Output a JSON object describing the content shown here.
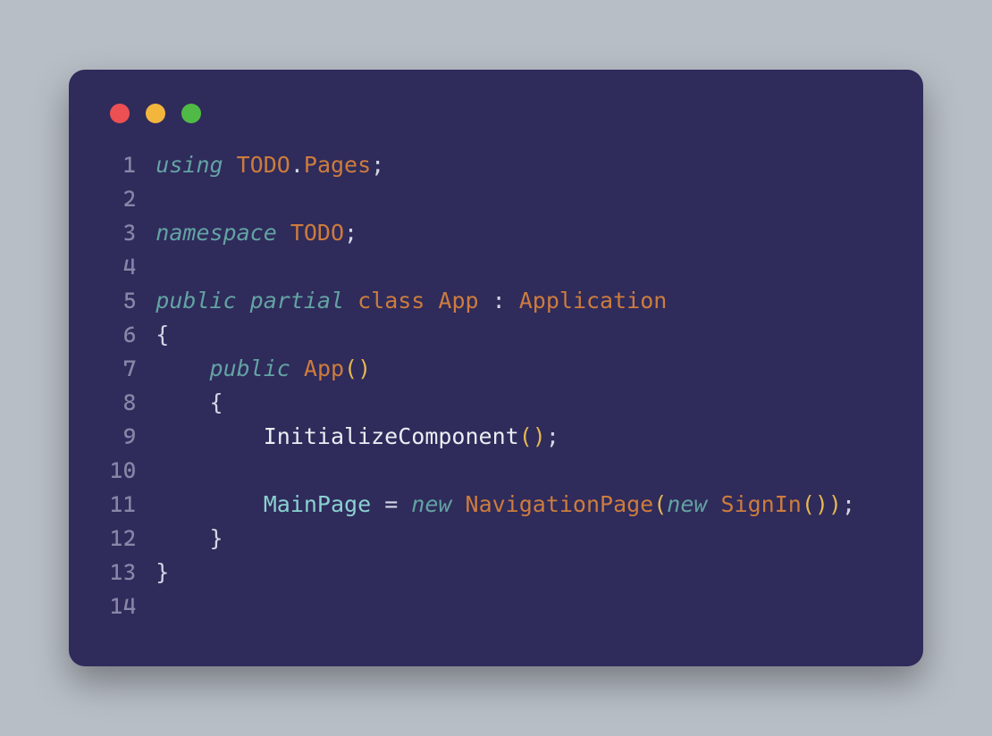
{
  "window": {
    "language": "csharp"
  },
  "lineNumbers": [
    "1",
    "2",
    "3",
    "4",
    "5",
    "6",
    "7",
    "8",
    "9",
    "10",
    "11",
    "12",
    "13",
    "14"
  ],
  "lines": [
    [
      {
        "cls": "tk-kw",
        "t": "using"
      },
      {
        "cls": "tk-punc",
        "t": " "
      },
      {
        "cls": "tk-decl",
        "t": "TODO"
      },
      {
        "cls": "tk-punc",
        "t": "."
      },
      {
        "cls": "tk-decl",
        "t": "Pages"
      },
      {
        "cls": "tk-punc",
        "t": ";"
      }
    ],
    [],
    [
      {
        "cls": "tk-kw",
        "t": "namespace"
      },
      {
        "cls": "tk-punc",
        "t": " "
      },
      {
        "cls": "tk-decl",
        "t": "TODO"
      },
      {
        "cls": "tk-punc",
        "t": ";"
      }
    ],
    [],
    [
      {
        "cls": "tk-kw",
        "t": "public"
      },
      {
        "cls": "tk-punc",
        "t": " "
      },
      {
        "cls": "tk-kw",
        "t": "partial"
      },
      {
        "cls": "tk-punc",
        "t": " "
      },
      {
        "cls": "tk-decl",
        "t": "class"
      },
      {
        "cls": "tk-punc",
        "t": " "
      },
      {
        "cls": "tk-decl",
        "t": "App"
      },
      {
        "cls": "tk-punc",
        "t": " : "
      },
      {
        "cls": "tk-decl",
        "t": "Application"
      }
    ],
    [
      {
        "cls": "tk-punc",
        "t": "{"
      }
    ],
    [
      {
        "cls": "tk-punc",
        "t": "    "
      },
      {
        "cls": "tk-kw",
        "t": "public"
      },
      {
        "cls": "tk-punc",
        "t": " "
      },
      {
        "cls": "tk-decl",
        "t": "App"
      },
      {
        "cls": "tk-paren",
        "t": "()"
      }
    ],
    [
      {
        "cls": "tk-punc",
        "t": "    {"
      }
    ],
    [
      {
        "cls": "tk-punc",
        "t": "        "
      },
      {
        "cls": "tk-method",
        "t": "InitializeComponent"
      },
      {
        "cls": "tk-paren",
        "t": "()"
      },
      {
        "cls": "tk-punc",
        "t": ";"
      }
    ],
    [],
    [
      {
        "cls": "tk-punc",
        "t": "        "
      },
      {
        "cls": "tk-prop",
        "t": "MainPage"
      },
      {
        "cls": "tk-punc",
        "t": " = "
      },
      {
        "cls": "tk-kw",
        "t": "new"
      },
      {
        "cls": "tk-punc",
        "t": " "
      },
      {
        "cls": "tk-decl",
        "t": "NavigationPage"
      },
      {
        "cls": "tk-paren",
        "t": "("
      },
      {
        "cls": "tk-kw",
        "t": "new"
      },
      {
        "cls": "tk-punc",
        "t": " "
      },
      {
        "cls": "tk-decl",
        "t": "SignIn"
      },
      {
        "cls": "tk-paren",
        "t": "())"
      },
      {
        "cls": "tk-punc",
        "t": ";"
      }
    ],
    [
      {
        "cls": "tk-punc",
        "t": "    }"
      }
    ],
    [
      {
        "cls": "tk-punc",
        "t": "}"
      }
    ],
    []
  ]
}
